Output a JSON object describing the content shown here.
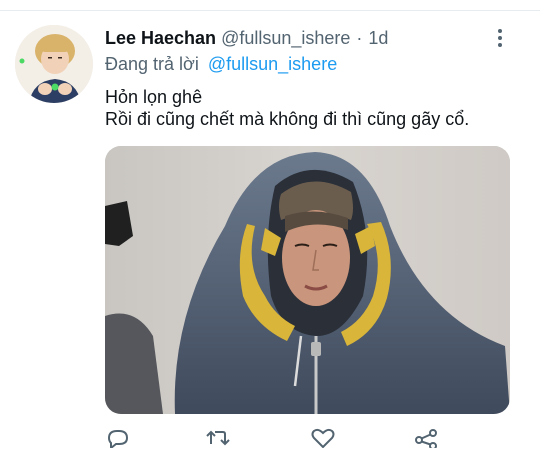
{
  "tweet": {
    "display_name": "Lee Haechan",
    "handle": "@fullsun_ishere",
    "separator": "·",
    "time": "1d",
    "reply_prefix": "Đang trả lời",
    "reply_mention": "@fullsun_ishere",
    "text_line1": "Hỏn lọn ghê",
    "text_line2": "Rồi đi cũng chết mà không đi thì cũng gãy cổ."
  },
  "icons": {
    "more": "more-vertical-icon",
    "reply": "reply-icon",
    "retweet": "retweet-icon",
    "like": "heart-icon",
    "share": "share-icon"
  },
  "colors": {
    "text": "#0f1419",
    "secondary": "#536471",
    "accent": "#1d9bf0",
    "divider": "#e6ecf0"
  }
}
